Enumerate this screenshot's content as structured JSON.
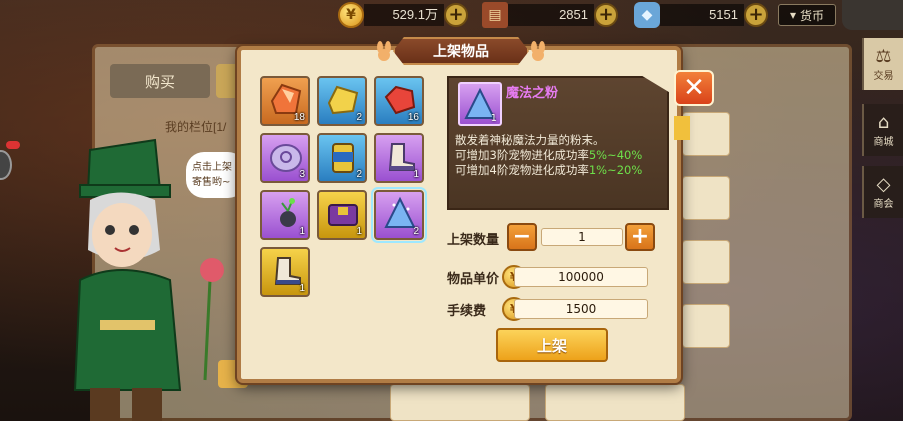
{
  "currency": {
    "gold": {
      "icon": "gold-coin-icon",
      "value": "529.1万"
    },
    "scroll": {
      "icon": "scroll-icon",
      "value": "2851"
    },
    "crystal": {
      "icon": "crystal-icon",
      "value": "5151"
    },
    "plus_label": "+",
    "dropdown_label": "货币"
  },
  "background": {
    "buy_tab": "购买",
    "my_slot": "我的栏位[1/",
    "bubble": "点击上架寄售哟~"
  },
  "side_tabs": [
    {
      "label": "交易",
      "icon": "scale-icon"
    },
    {
      "label": "商城",
      "icon": "shop-icon"
    },
    {
      "label": "商会",
      "icon": "diamond-icon"
    }
  ],
  "dialog": {
    "title": "上架物品",
    "close_label": "✕",
    "inventory": [
      {
        "name": "orange-crystal",
        "rarity": "orange",
        "count": "18"
      },
      {
        "name": "yellow-crystal",
        "rarity": "blue",
        "count": "2"
      },
      {
        "name": "red-crystal",
        "rarity": "blue",
        "count": "16"
      },
      {
        "name": "rune-stone",
        "rarity": "purple",
        "count": "3"
      },
      {
        "name": "tin-can",
        "rarity": "blue",
        "count": "2"
      },
      {
        "name": "boot",
        "rarity": "purple",
        "count": "1"
      },
      {
        "name": "flower-seed",
        "rarity": "purple",
        "count": "1"
      },
      {
        "name": "purple-belt",
        "rarity": "gold",
        "count": "1"
      },
      {
        "name": "magic-powder",
        "rarity": "purple",
        "count": "2",
        "selected": true
      },
      {
        "name": "gold-boot",
        "rarity": "gold",
        "count": "1"
      }
    ],
    "detail": {
      "name": "魔法之粉",
      "count": "1",
      "desc_intro": "散发着神秘魔法力量的粉末。",
      "line1_prefix": "可增加3阶宠物进化成功率",
      "line1_value": "5%~40%",
      "line2_prefix": "可增加4阶宠物进化成功率",
      "line2_value": "1%~20%"
    },
    "form": {
      "qty_label": "上架数量",
      "qty_value": "1",
      "minus_label": "−",
      "plus_label": "+",
      "price_label": "物品单价",
      "price_value": "100000",
      "fee_label": "手续费",
      "fee_value": "1500",
      "coin_glyph": "¥"
    },
    "submit_label": "上架"
  },
  "colors": {
    "accent_orange": "#e8901f",
    "rarity_purple": "#9a50d0",
    "rarity_gold": "#c8960e",
    "rarity_blue": "#2a7ec0",
    "rarity_orange": "#c86a20",
    "highlight_green": "#6ee04a",
    "name_pink": "#e77cf2"
  }
}
